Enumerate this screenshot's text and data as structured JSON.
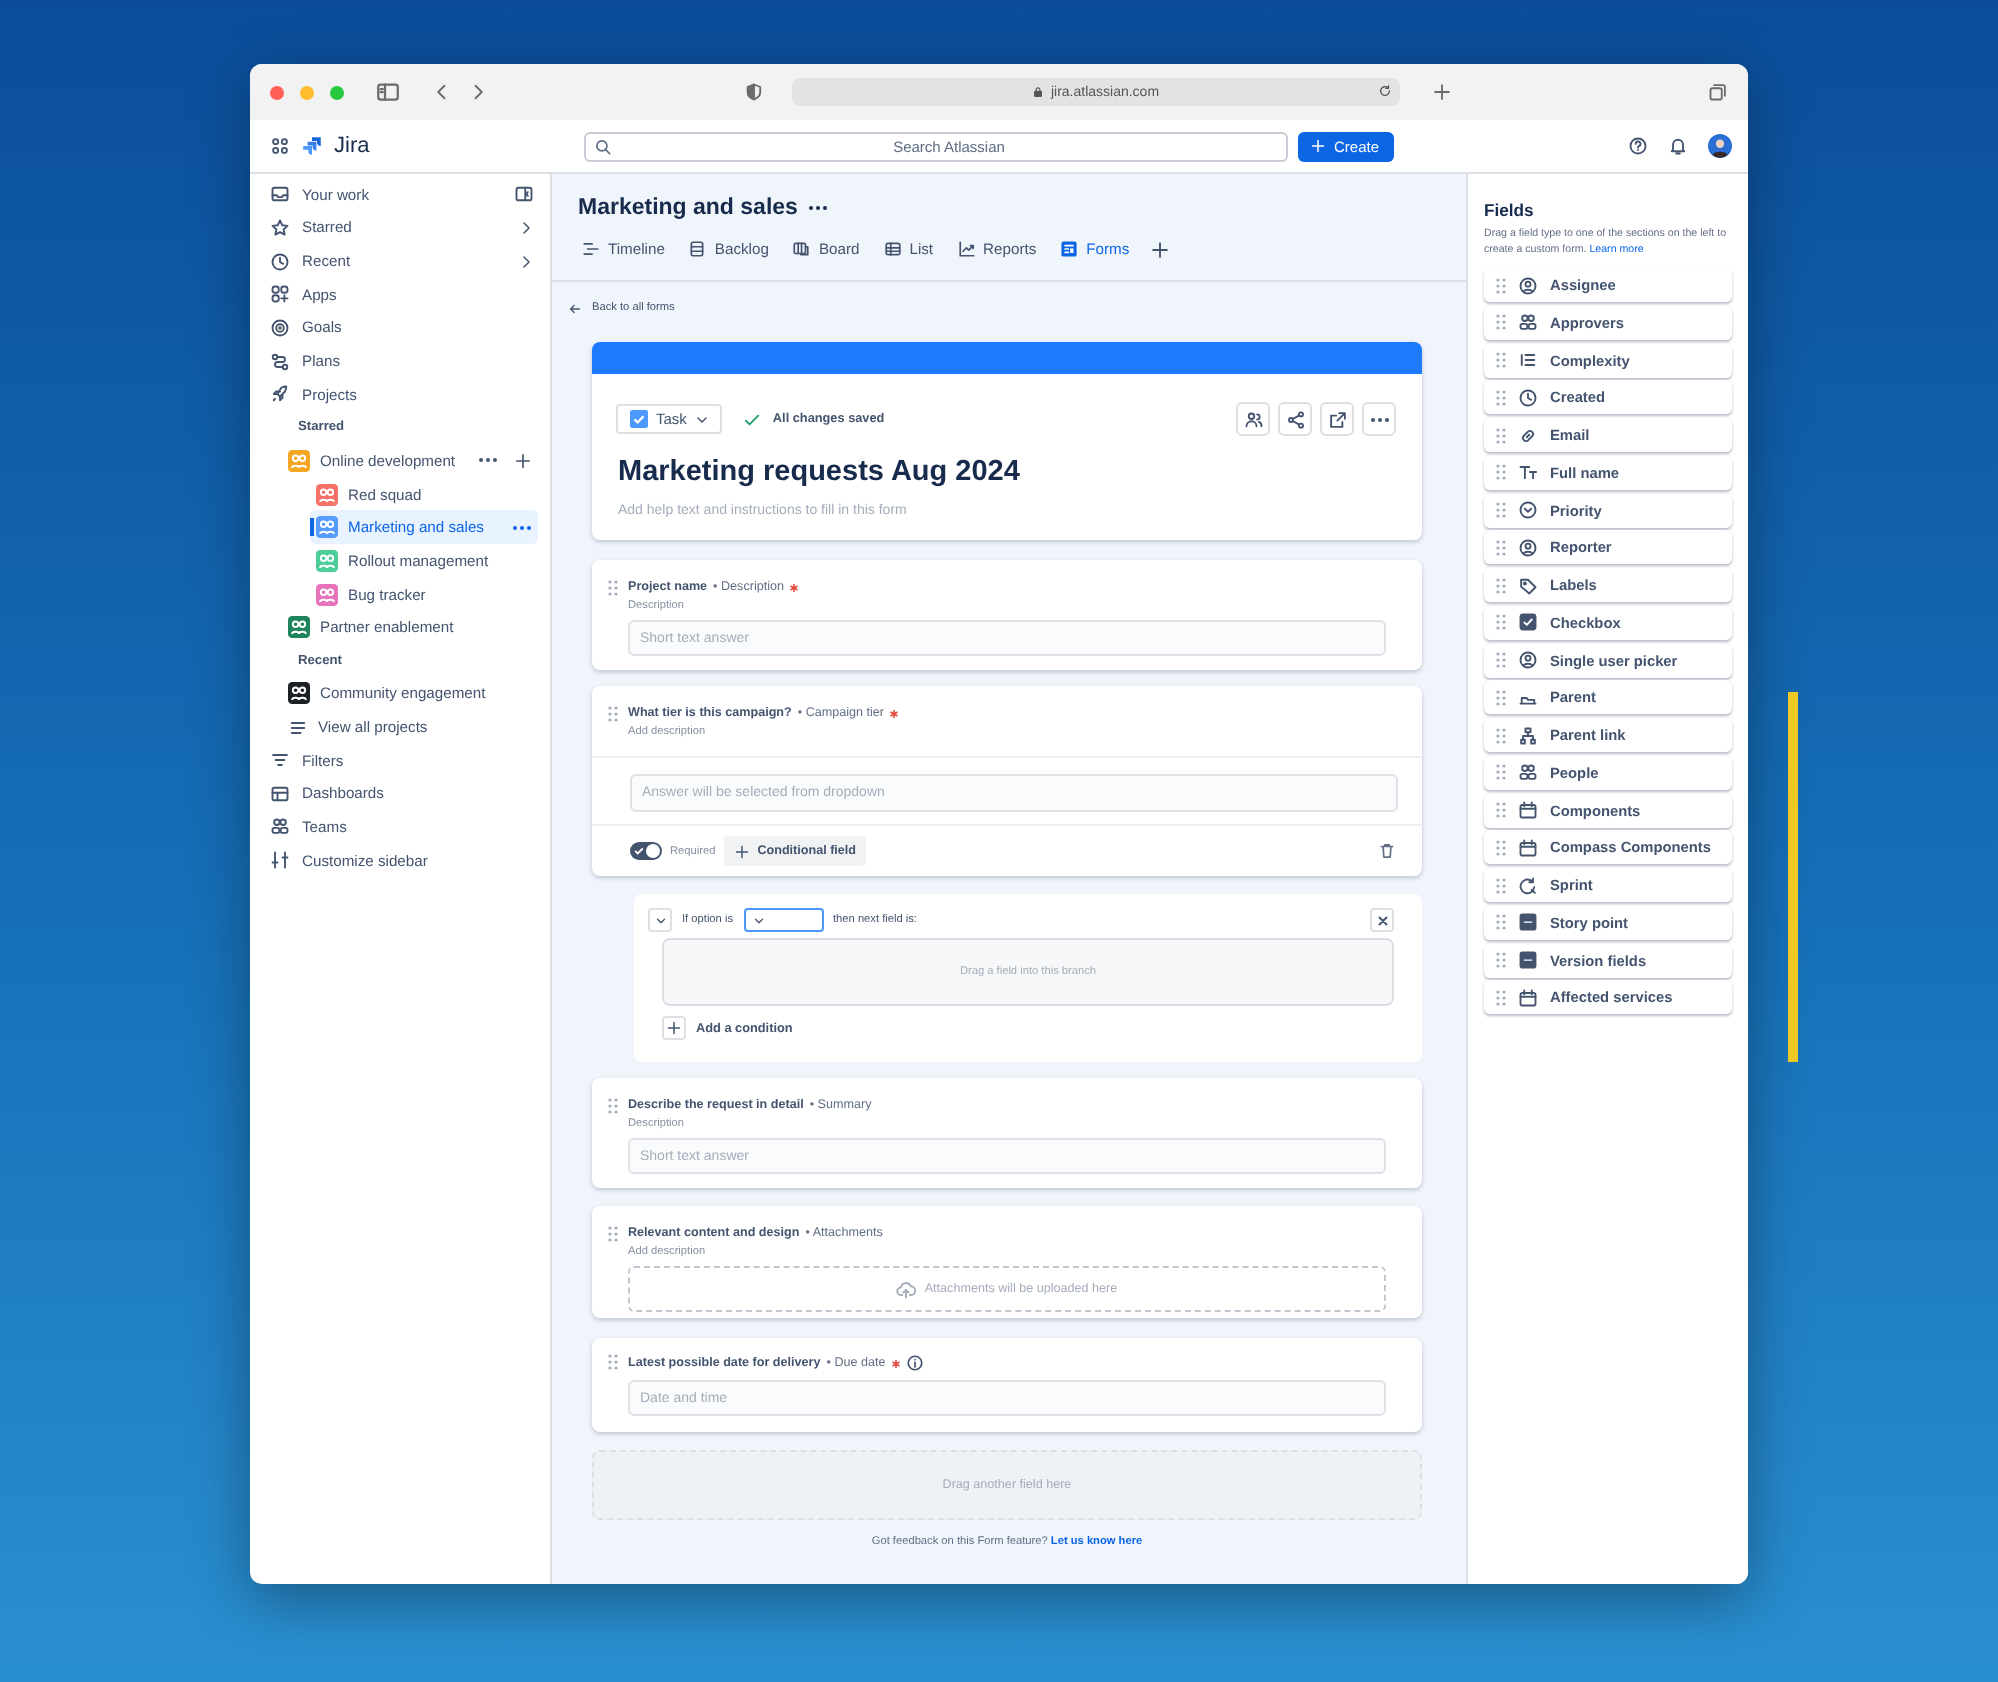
{
  "browser": {
    "url": "jira.atlassian.com"
  },
  "topbar": {
    "product": "Jira",
    "search_placeholder": "Search Atlassian",
    "create_button": "Create"
  },
  "sidebar": {
    "nav_top": [
      {
        "label": "Your work"
      },
      {
        "label": "Starred"
      },
      {
        "label": "Recent"
      },
      {
        "label": "Apps"
      },
      {
        "label": "Goals"
      },
      {
        "label": "Plans"
      },
      {
        "label": "Projects"
      }
    ],
    "starred_heading": "Starred",
    "starred": [
      {
        "name": "Online development",
        "color": "#f5a623",
        "selected": false,
        "children": [
          {
            "name": "Red squad",
            "color": "#f87168",
            "selected": false
          },
          {
            "name": "Marketing and sales",
            "color": "#579dff",
            "selected": true
          },
          {
            "name": "Rollout management",
            "color": "#4bce97",
            "selected": false
          },
          {
            "name": "Bug tracker",
            "color": "#e774bb",
            "selected": false
          }
        ]
      },
      {
        "name": "Partner enablement",
        "color": "#1f845a",
        "selected": false
      }
    ],
    "recent_heading": "Recent",
    "recent": [
      {
        "name": "Community engagement",
        "color": "#1d2125",
        "selected": false
      }
    ],
    "view_all": "View all projects",
    "nav_bottom": [
      {
        "label": "Filters"
      },
      {
        "label": "Dashboards"
      },
      {
        "label": "Teams"
      },
      {
        "label": "Customize sidebar"
      }
    ]
  },
  "project": {
    "title": "Marketing and sales",
    "tabs": [
      {
        "label": "Timeline",
        "selected": false
      },
      {
        "label": "Backlog",
        "selected": false
      },
      {
        "label": "Board",
        "selected": false
      },
      {
        "label": "List",
        "selected": false
      },
      {
        "label": "Reports",
        "selected": false
      },
      {
        "label": "Forms",
        "selected": true
      }
    ]
  },
  "back_link": "Back to all forms",
  "form": {
    "issue_type": "Task",
    "save_status": "All changes saved",
    "title": "Marketing requests Aug 2024",
    "help_placeholder": "Add help text and instructions to fill in this form"
  },
  "fields": [
    {
      "kind": "text",
      "question": "Project name",
      "field_type": "• Description",
      "required": true,
      "description": "Description",
      "placeholder": "Short text answer"
    },
    {
      "kind": "dropdown",
      "question": "What tier is this campaign?",
      "field_type": "• Campaign tier",
      "required": true,
      "description": "Add description",
      "placeholder": "Answer will be selected from dropdown",
      "toggle": {
        "label": "Required",
        "on": true
      },
      "conditional_button": "Conditional field"
    },
    {
      "kind": "condition",
      "if_label": "If option is",
      "then_label": "then next field is:",
      "drop_hint": "Drag a field into this branch",
      "add_condition": "Add a condition"
    },
    {
      "kind": "text",
      "question": "Describe the request in detail",
      "field_type": "• Summary",
      "required": false,
      "description": "Description",
      "placeholder": "Short text answer"
    },
    {
      "kind": "attachment",
      "question": "Relevant content and design",
      "field_type": "• Attachments",
      "required": false,
      "description": "Add description",
      "drop_text": "Attachments will be uploaded here"
    },
    {
      "kind": "date",
      "question": "Latest possible date for delivery",
      "field_type": "• Due date",
      "required": true,
      "placeholder": "Date and time"
    }
  ],
  "drop_zone": "Drag another field here",
  "feedback": {
    "text": "Got feedback on this Form feature?",
    "link": "Let us know here"
  },
  "fields_panel": {
    "title": "Fields",
    "hint": "Drag a field type to one of the sections on the left to create a custom form.",
    "link": "Learn more",
    "items": [
      "Assignee",
      "Approvers",
      "Complexity",
      "Created",
      "Email",
      "Full name",
      "Priority",
      "Reporter",
      "Labels",
      "Checkbox",
      "Single user picker",
      "Parent",
      "Parent link",
      "People",
      "Components",
      "Compass Components",
      "Sprint",
      "Story point",
      "Version fields",
      "Affected services"
    ]
  }
}
